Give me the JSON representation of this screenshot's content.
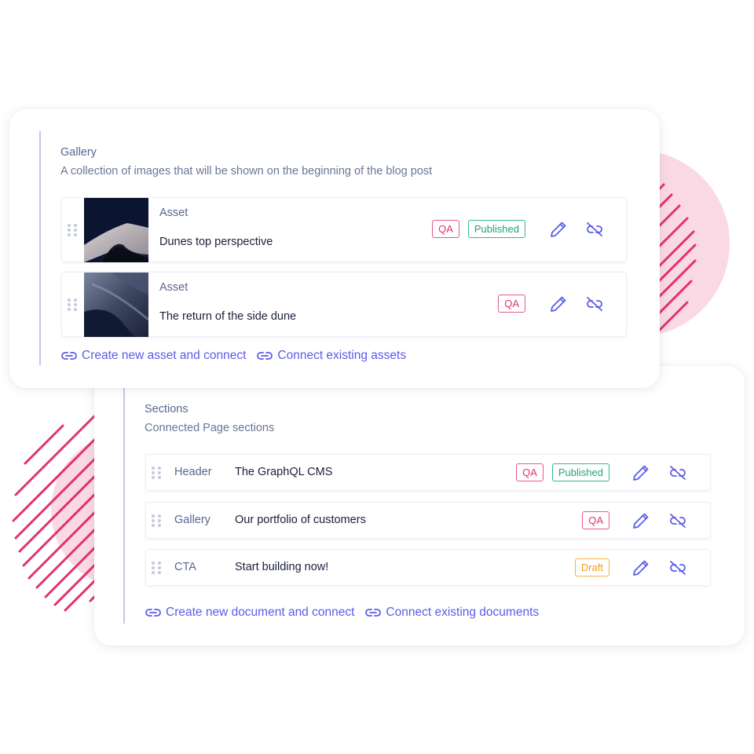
{
  "colors": {
    "accent": "#5b5ce8",
    "qa": "#e0336b",
    "published": "#1fa57a",
    "draft": "#f0a020",
    "decoration_pink": "#fbd9e4",
    "decoration_stripe": "#e0336b"
  },
  "gallery": {
    "title": "Gallery",
    "description": "A collection of images that will be shown on the beginning of the blog post",
    "items": [
      {
        "type": "Asset",
        "name": "Dunes top perspective",
        "thumbnail": "dune-top-image",
        "badges": [
          {
            "label": "QA",
            "kind": "qa"
          },
          {
            "label": "Published",
            "kind": "published"
          }
        ],
        "icons": {
          "drag": "drag-handle-icon",
          "edit": "pencil-icon",
          "unlink": "unlink-icon"
        }
      },
      {
        "type": "Asset",
        "name": "The return of the side dune",
        "thumbnail": "dune-side-image",
        "badges": [
          {
            "label": "QA",
            "kind": "qa"
          }
        ],
        "icons": {
          "drag": "drag-handle-icon",
          "edit": "pencil-icon",
          "unlink": "unlink-icon"
        }
      }
    ],
    "actions": [
      {
        "label": "Create new asset and connect",
        "icon": "link-icon"
      },
      {
        "label": "Connect existing assets",
        "icon": "link-icon"
      }
    ]
  },
  "sections": {
    "title": "Sections",
    "description": "Connected Page sections",
    "items": [
      {
        "type": "Header",
        "name": "The GraphQL CMS",
        "badges": [
          {
            "label": "QA",
            "kind": "qa"
          },
          {
            "label": "Published",
            "kind": "published"
          }
        ]
      },
      {
        "type": "Gallery",
        "name": "Our portfolio of customers",
        "badges": [
          {
            "label": "QA",
            "kind": "qa"
          }
        ]
      },
      {
        "type": "CTA",
        "name": "Start building now!",
        "badges": [
          {
            "label": "Draft",
            "kind": "draft"
          }
        ]
      }
    ],
    "actions": [
      {
        "label": "Create new document and connect",
        "icon": "link-icon"
      },
      {
        "label": "Connect existing documents",
        "icon": "link-icon"
      }
    ]
  }
}
